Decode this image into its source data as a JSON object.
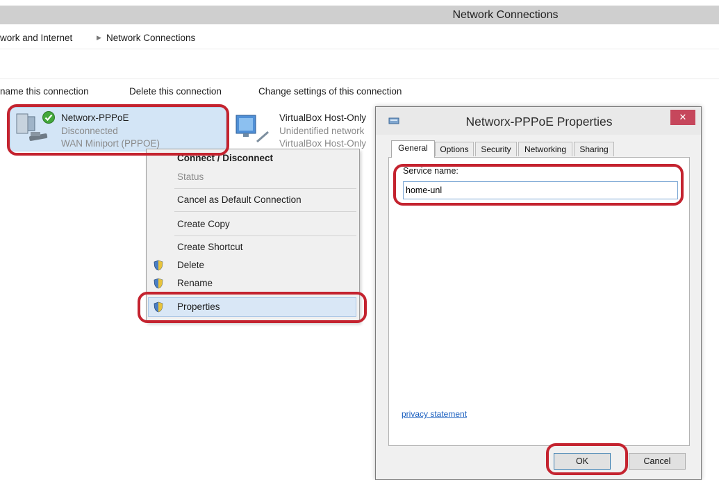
{
  "window": {
    "title": "Network Connections"
  },
  "address": {
    "crumbs": [
      "work and Internet",
      "Network Connections"
    ]
  },
  "commands": [
    "name this connection",
    "Delete this connection",
    "Change settings of this connection"
  ],
  "connections": [
    {
      "name": "Networx-PPPoE",
      "status": "Disconnected",
      "device": "WAN Miniport (PPPOE)"
    },
    {
      "name": "VirtualBox Host-Only",
      "status": "Unidentified network",
      "device": "VirtualBox Host-Only"
    }
  ],
  "context_menu": {
    "items": [
      "Connect / Disconnect",
      "Status",
      "Cancel as Default Connection",
      "Create Copy",
      "Create Shortcut",
      "Delete",
      "Rename",
      "Properties"
    ]
  },
  "dialog": {
    "title": "Networx-PPPoE Properties",
    "close_glyph": "✕",
    "tabs": [
      "General",
      "Options",
      "Security",
      "Networking",
      "Sharing"
    ],
    "active_tab": "General",
    "service_label": "Service name:",
    "service_value": "home-unl",
    "privacy_link": "privacy statement",
    "ok_label": "OK",
    "cancel_label": "Cancel"
  },
  "colors": {
    "highlight": "#c4232f",
    "selection": "#d3e5f6",
    "close_button": "#c6475c"
  }
}
